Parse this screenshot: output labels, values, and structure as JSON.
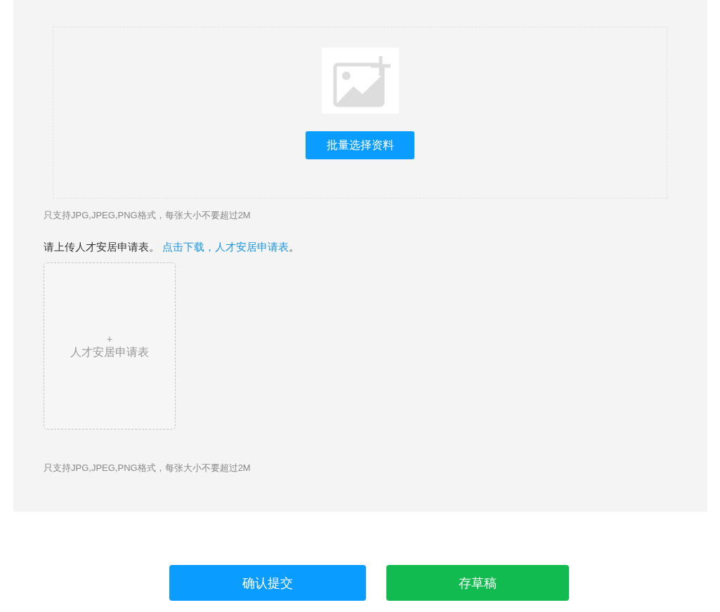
{
  "batch_upload": {
    "button": "批量选择资料",
    "hint": "只支持JPG,JPEG,PNG格式，每张大小不要超过2M"
  },
  "form_upload": {
    "prompt": "请上传人才安居申请表。 ",
    "link": "点击下载，人才安居申请表",
    "suffix": "。",
    "card_plus": "+",
    "card_label": "人才安居申请表",
    "hint": "只支持JPG,JPEG,PNG格式，每张大小不要超过2M"
  },
  "actions": [
    {
      "label": "确认提交",
      "kind": "primary"
    },
    {
      "label": "存草稿",
      "kind": "success"
    }
  ]
}
